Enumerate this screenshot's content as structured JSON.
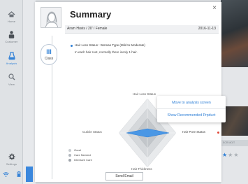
{
  "sidebar": {
    "items": [
      {
        "label": "Home",
        "icon": "home-icon"
      },
      {
        "label": "Customer",
        "icon": "customer-icon"
      },
      {
        "label": "Analysis",
        "icon": "analysis-icon"
      },
      {
        "label": "View",
        "icon": "search-icon"
      },
      {
        "label": "Settings",
        "icon": "gear-icon"
      }
    ],
    "active_index": 2
  },
  "summary": {
    "title": "Summary",
    "patient": "Aram Huvis / 20' / Female",
    "date": "2016-11-13",
    "class_grade": "III",
    "class_label": "Class",
    "status_line": "Hair Loss Status : Woman Type (Mild to Moderate)",
    "status_desc": "In each hair root, normally there isonly 1 hair."
  },
  "radar": {
    "axes": [
      "Hair Loss Status",
      "Cuticle Status",
      "Hair Pore Status",
      "Hair Thickness"
    ],
    "legend": [
      {
        "label": "Good",
        "color": "#c9cdd1"
      },
      {
        "label": "Care Needed",
        "color": "#b3b8be"
      },
      {
        "label": "Intensive Care",
        "color": "#9ea4ab"
      }
    ]
  },
  "actions": {
    "send_email": "Send Email"
  },
  "popup": {
    "move_to_analysis": "Move to analysis screen",
    "show_recommended": "Show Recommended Prpduct"
  },
  "background": {
    "chip_text": "ECR MOIT"
  },
  "colors": {
    "accent": "#2e7fd6",
    "alert": "#e24a3b"
  }
}
